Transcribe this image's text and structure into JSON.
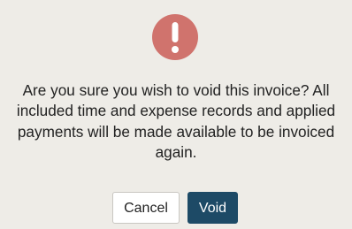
{
  "dialog": {
    "icon": "exclamation-icon",
    "icon_color": "#d0736d",
    "message": "Are you sure you wish to void this invoice? All included time and expense records and applied payments will be made available to be invoiced again.",
    "cancel_label": "Cancel",
    "void_label": "Void",
    "void_color": "#1d4a66"
  }
}
